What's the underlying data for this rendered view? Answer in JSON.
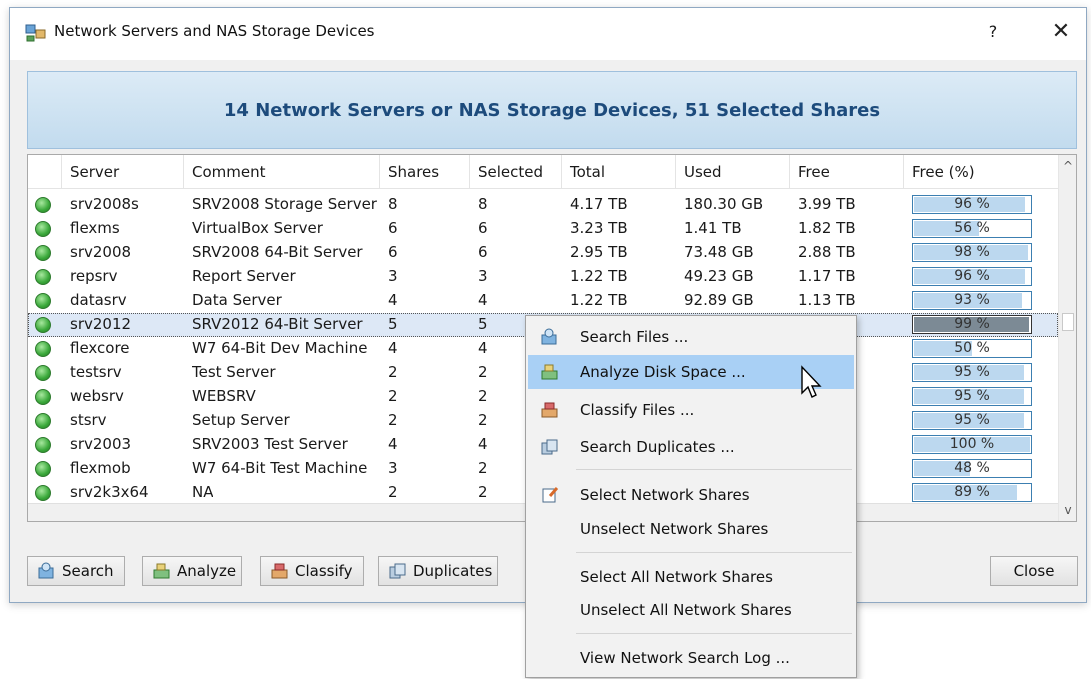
{
  "window": {
    "title": "Network Servers and NAS Storage Devices",
    "help": "?",
    "close": "✕"
  },
  "banner": "14 Network Servers or NAS Storage Devices, 51 Selected Shares",
  "columns": [
    "Server",
    "Comment",
    "Shares",
    "Selected",
    "Total",
    "Used",
    "Free",
    "Free (%)"
  ],
  "rows": [
    {
      "server": "srv2008s",
      "comment": "SRV2008 Storage Server",
      "shares": "8",
      "selected": "8",
      "total": "4.17 TB",
      "used": "180.30 GB",
      "free": "3.99 TB",
      "pct": "96 %",
      "fill": 0.96
    },
    {
      "server": "flexms",
      "comment": "VirtualBox Server",
      "shares": "6",
      "selected": "6",
      "total": "3.23 TB",
      "used": "1.41 TB",
      "free": "1.82 TB",
      "pct": "56 %",
      "fill": 0.56
    },
    {
      "server": "srv2008",
      "comment": "SRV2008 64-Bit Server",
      "shares": "6",
      "selected": "6",
      "total": "2.95 TB",
      "used": "73.48 GB",
      "free": "2.88 TB",
      "pct": "98 %",
      "fill": 0.98
    },
    {
      "server": "repsrv",
      "comment": "Report Server",
      "shares": "3",
      "selected": "3",
      "total": "1.22 TB",
      "used": "49.23 GB",
      "free": "1.17 TB",
      "pct": "96 %",
      "fill": 0.96
    },
    {
      "server": "datasrv",
      "comment": "Data Server",
      "shares": "4",
      "selected": "4",
      "total": "1.22 TB",
      "used": "92.89 GB",
      "free": "1.13 TB",
      "pct": "93 %",
      "fill": 0.93
    },
    {
      "server": "srv2012",
      "comment": "SRV2012 64-Bit Server",
      "shares": "5",
      "selected": "5",
      "total": "",
      "used": "",
      "free": "",
      "pct": "99 %",
      "fill": 0.99
    },
    {
      "server": "flexcore",
      "comment": "W7 64-Bit Dev Machine",
      "shares": "4",
      "selected": "4",
      "total": "",
      "used": "",
      "free": "GB",
      "pct": "50 %",
      "fill": 0.5
    },
    {
      "server": "testsrv",
      "comment": "Test Server",
      "shares": "2",
      "selected": "2",
      "total": "",
      "used": "",
      "free": "GB",
      "pct": "95 %",
      "fill": 0.95
    },
    {
      "server": "websrv",
      "comment": "WEBSRV",
      "shares": "2",
      "selected": "2",
      "total": "",
      "used": "",
      "free": "GB",
      "pct": "95 %",
      "fill": 0.95
    },
    {
      "server": "stsrv",
      "comment": "Setup Server",
      "shares": "2",
      "selected": "2",
      "total": "",
      "used": "",
      "free": "GB",
      "pct": "95 %",
      "fill": 0.95
    },
    {
      "server": "srv2003",
      "comment": "SRV2003 Test Server",
      "shares": "4",
      "selected": "4",
      "total": "",
      "used": "",
      "free": "GB",
      "pct": "100 %",
      "fill": 1.0
    },
    {
      "server": "flexmob",
      "comment": "W7 64-Bit Test Machine",
      "shares": "3",
      "selected": "2",
      "total": "",
      "used": "",
      "free": "GB",
      "pct": "48 %",
      "fill": 0.48
    },
    {
      "server": "srv2k3x64",
      "comment": "NA",
      "shares": "2",
      "selected": "2",
      "total": "",
      "used": "",
      "free": "GB",
      "pct": "89 %",
      "fill": 0.89
    }
  ],
  "selected_row": 5,
  "buttons": {
    "search": "Search",
    "analyze": "Analyze",
    "classify": "Classify",
    "duplicates": "Duplicates",
    "close": "Close"
  },
  "context_menu": {
    "items": [
      "Search Files ...",
      "Analyze Disk Space ...",
      "Classify Files ...",
      "Search Duplicates ...",
      "Select Network Shares",
      "Unselect Network Shares",
      "Select All Network Shares",
      "Unselect All Network Shares",
      "View Network Search Log ..."
    ],
    "highlighted": 1
  },
  "colors": {
    "banner_text": "#1d4b7c",
    "menu_highlight": "#a9d0f5",
    "status_ok": "#3aa83a"
  }
}
